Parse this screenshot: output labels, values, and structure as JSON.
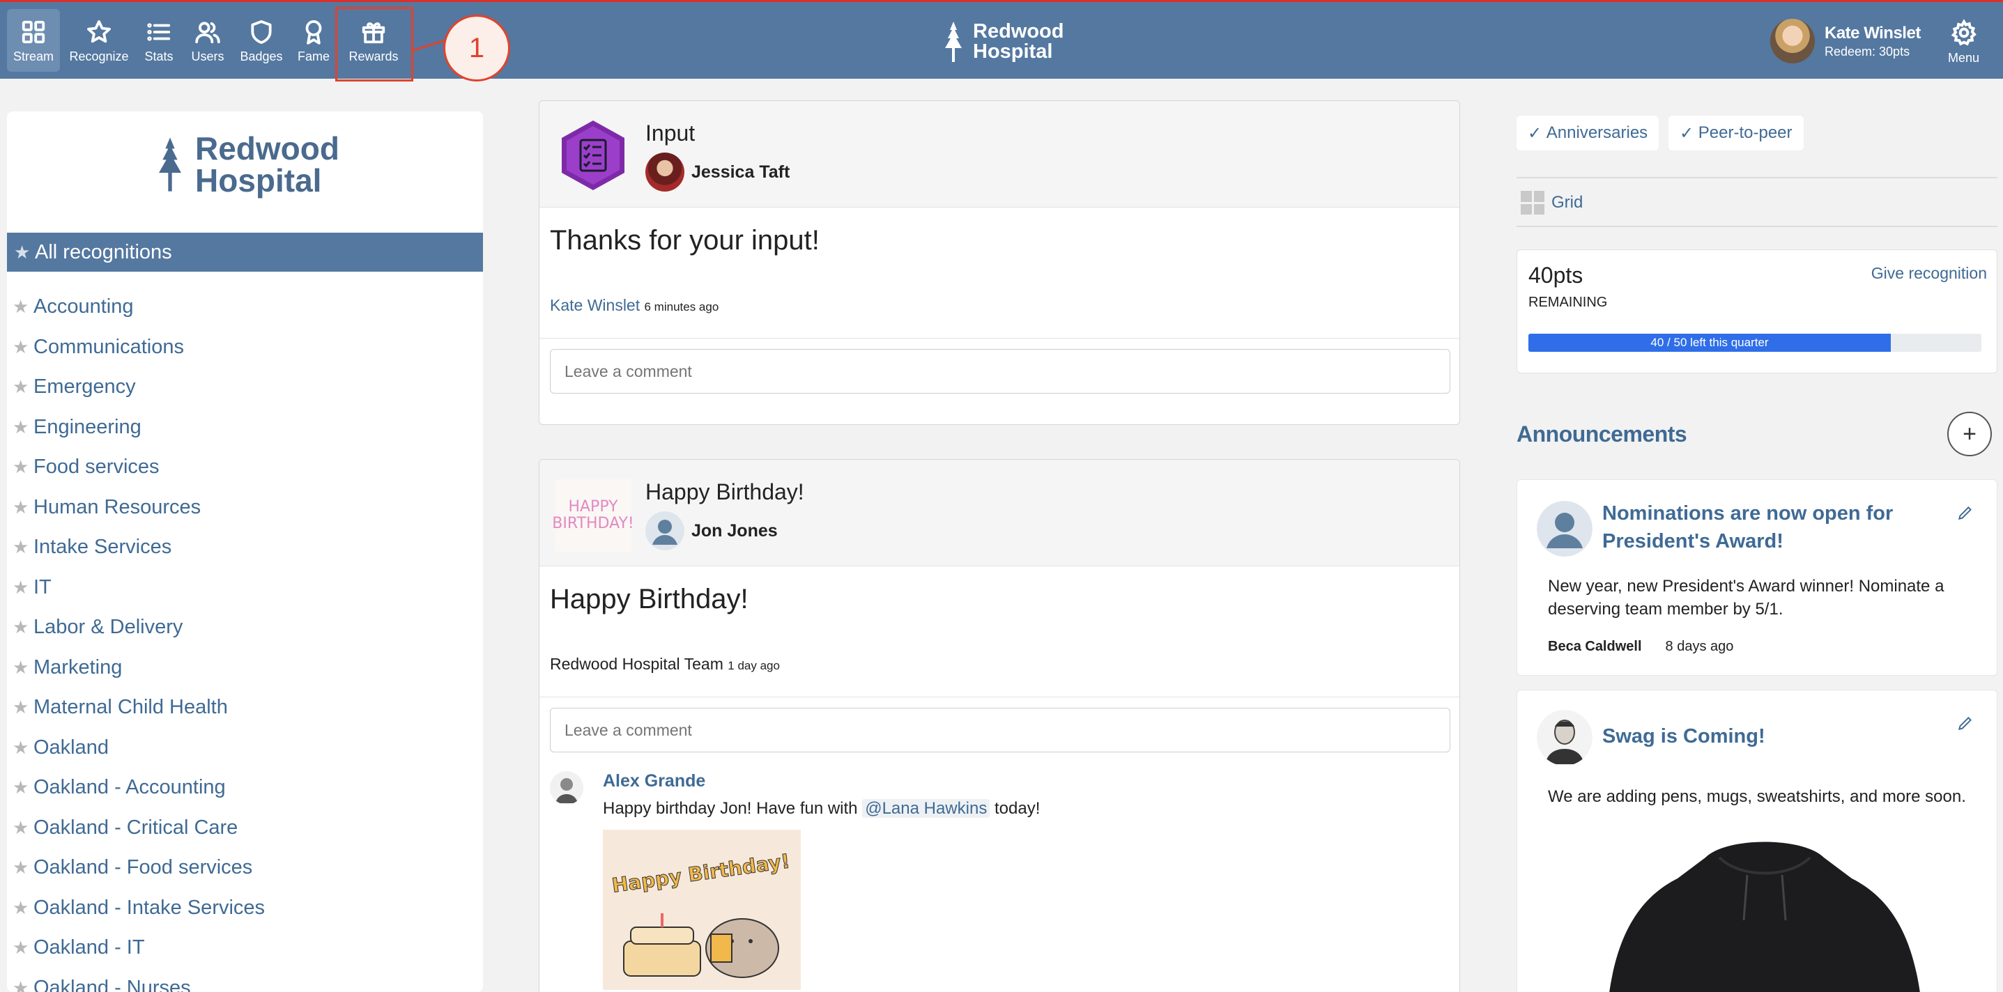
{
  "nav": {
    "items": [
      {
        "label": "Stream",
        "icon": "grid-icon"
      },
      {
        "label": "Recognize",
        "icon": "star-icon"
      },
      {
        "label": "Stats",
        "icon": "list-icon"
      },
      {
        "label": "Users",
        "icon": "users-icon"
      },
      {
        "label": "Badges",
        "icon": "shield-icon"
      },
      {
        "label": "Fame",
        "icon": "award-icon"
      },
      {
        "label": "Rewards",
        "icon": "gift-icon"
      }
    ],
    "active": "Stream",
    "callout_number": "1",
    "brand_line1": "Redwood",
    "brand_line2": "Hospital",
    "user_name": "Kate Winslet",
    "user_redeem": "Redeem: 30pts",
    "menu_label": "Menu"
  },
  "sidebar": {
    "brand_line1": "Redwood",
    "brand_line2": "Hospital",
    "active_category": "All recognitions",
    "categories": [
      "Accounting",
      "Communications",
      "Emergency",
      "Engineering",
      "Food services",
      "Human Resources",
      "Intake Services",
      "IT",
      "Labor & Delivery",
      "Marketing",
      "Maternal Child Health",
      "Oakland",
      "Oakland - Accounting",
      "Oakland - Critical Care",
      "Oakland - Food services",
      "Oakland - Intake Services",
      "Oakland - IT",
      "Oakland - Nurses"
    ]
  },
  "feed": {
    "posts": [
      {
        "title": "Input",
        "recipient": "Jessica Taft",
        "message": "Thanks for your input!",
        "author": "Kate Winslet",
        "ago": "6 minutes ago",
        "comment_placeholder": "Leave a comment"
      },
      {
        "title": "Happy Birthday!",
        "badge_text": "HAPPY BIRTHDAY!",
        "recipient": "Jon Jones",
        "message": "Happy Birthday!",
        "author": "Redwood Hospital Team",
        "ago": "1 day ago",
        "comment_placeholder": "Leave a comment",
        "comment": {
          "author": "Alex Grande",
          "text_before": "Happy birthday Jon! Have fun with ",
          "mention": "@Lana Hawkins",
          "text_after": " today!",
          "gif_text": "Happy Birthday!"
        }
      }
    ]
  },
  "right": {
    "filters": [
      "Anniversaries",
      "Peer-to-peer"
    ],
    "filter_check": "✓",
    "grid_label": "Grid",
    "points": {
      "value": "40pts",
      "label": "REMAINING",
      "give_label": "Give recognition",
      "progress_text": "40 / 50 left this quarter",
      "progress_fraction": 0.8,
      "progress_color": "#2f6ee8"
    },
    "announcements_title": "Announcements",
    "add_label": "+",
    "announcements": [
      {
        "title_line1": "Nominations are now open for",
        "title_line2": "President's Award!",
        "body_line1": "New year, new President's Award winner! Nominate a",
        "body_line2": "deserving team member by 5/1.",
        "author": "Beca Caldwell",
        "ago": "8 days ago"
      },
      {
        "title_line1": "Swag is Coming!",
        "body_line1": "We are adding pens, mugs, sweatshirts, and more soon."
      }
    ]
  },
  "colors": {
    "nav_bg": "#5478a0",
    "link": "#3f6a94",
    "highlight": "#e0432d"
  }
}
